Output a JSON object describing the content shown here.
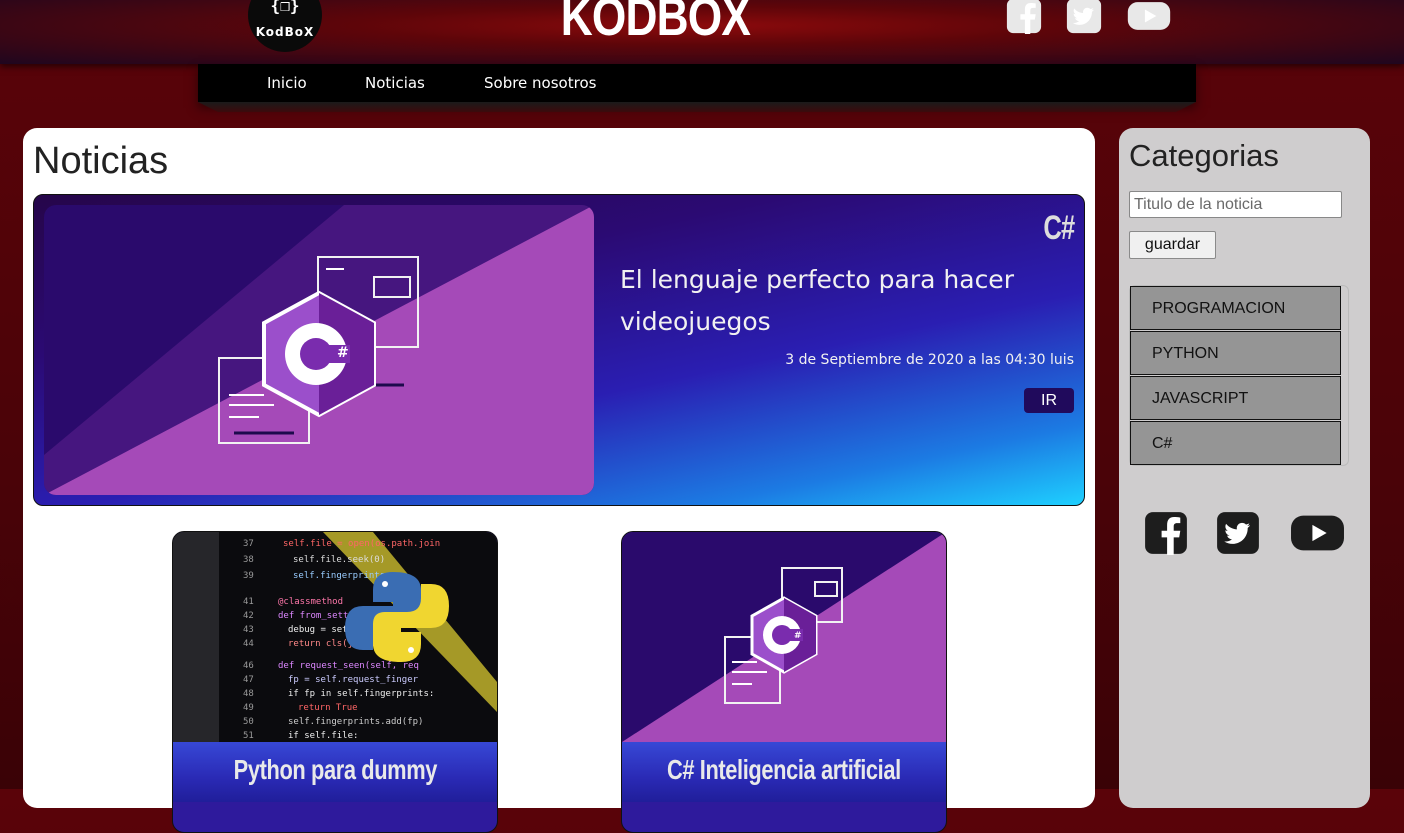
{
  "header": {
    "logo_glyph": "{❒}",
    "logo_text": "KodBoX",
    "brand": "KODBOX",
    "social": [
      "facebook-icon",
      "twitter-icon",
      "youtube-icon"
    ]
  },
  "nav": {
    "items": [
      {
        "label": "Inicio"
      },
      {
        "label": "Noticias"
      },
      {
        "label": "Sobre nosotros"
      }
    ]
  },
  "main": {
    "title": "Noticias",
    "featured": {
      "tag": "C#",
      "title": "El lenguaje perfecto para hacer videojuegos",
      "date": "3 de Septiembre de 2020 a las 04:30 luis",
      "button": "IR"
    },
    "cards": [
      {
        "title": "Python para dummy",
        "image": "python-code-image"
      },
      {
        "title": "C# Inteligencia artificial",
        "image": "csharp-image"
      }
    ]
  },
  "sidebar": {
    "title": "Categorias",
    "input_placeholder": "Titulo de la noticia",
    "button": "guardar",
    "categories": [
      "PROGRAMACION",
      "PYTHON",
      "JAVASCRIPT",
      "C#"
    ],
    "social": [
      "facebook-icon",
      "twitter-icon",
      "youtube-icon"
    ]
  },
  "colors": {
    "background": "#4a0308",
    "nav": "#000000",
    "sidebar": "#cfcdce",
    "category_bg": "#959595",
    "featured_accent": "#2a1eb2",
    "button_dark": "#200a5c"
  }
}
